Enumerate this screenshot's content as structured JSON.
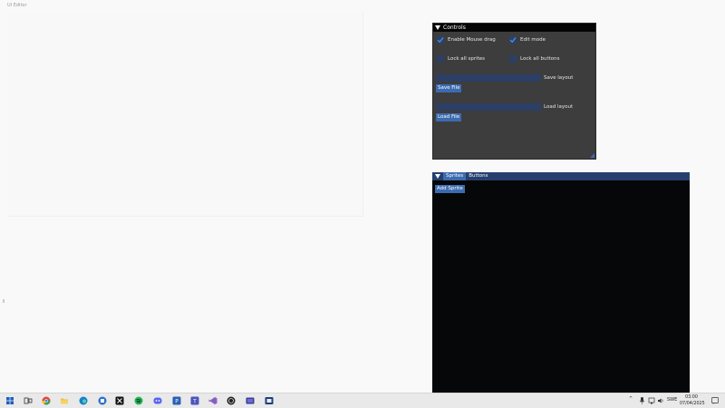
{
  "app": {
    "title": "UI Editor"
  },
  "controls": {
    "header": "Controls",
    "enable_mouse_drag": {
      "label": "Enable Mouse drag",
      "checked": true
    },
    "edit_mode": {
      "label": "Edit mode",
      "checked": true
    },
    "lock_all_sprites": {
      "label": "Lock all sprites",
      "checked": false
    },
    "lock_all_buttons": {
      "label": "Lock all buttons",
      "checked": false
    },
    "save_layout_label": "Save layout",
    "save_file_button": "Save File",
    "load_layout_label": "Load layout",
    "load_file_button": "Load File"
  },
  "sprites_panel": {
    "tabs": [
      {
        "label": "Sprites",
        "active": true
      },
      {
        "label": "Buttons",
        "active": false
      }
    ],
    "add_sprite_button": "Add Sprite"
  },
  "taskbar": {
    "apps": [
      "windows-icon",
      "task-view-icon",
      "chrome-icon",
      "file-explorer-icon",
      "edge-icon",
      "app-icon",
      "capcut-icon",
      "spotify-icon",
      "discord-icon",
      "app-icon",
      "teams-icon",
      "visual-studio-icon",
      "unity-icon",
      "app-icon",
      "app-icon"
    ],
    "language": "SWE",
    "time": "03:00",
    "date": "07/04/2025"
  },
  "colors": {
    "accent": "#3c6bb0",
    "panel_bg": "#3d3d3d",
    "checkbox_bg": "#2c3f66",
    "tab_bar": "#263f6f"
  }
}
